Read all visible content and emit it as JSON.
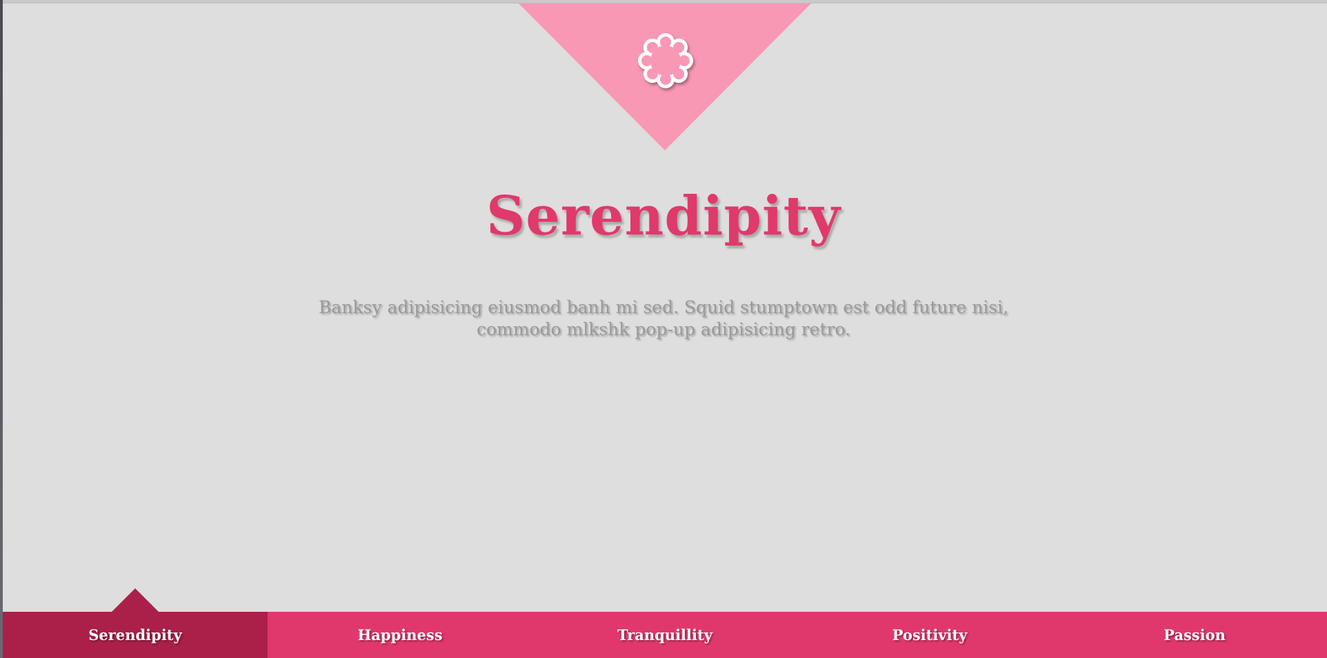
{
  "colors": {
    "background": "#dedede",
    "banner": "#f898b4",
    "accent": "#e0396b",
    "nav": "#e0386c",
    "nav_active": "#aa2048",
    "description": "#9a9a9a"
  },
  "banner": {
    "icon": "flower-icon"
  },
  "hero": {
    "title": "Serendipity",
    "description": "Banksy adipisicing eiusmod banh mi sed. Squid stumptown est odd future nisi, commodo mlkshk pop-up adipisicing retro."
  },
  "nav": {
    "items": [
      {
        "label": "Serendipity",
        "active": true
      },
      {
        "label": "Happiness",
        "active": false
      },
      {
        "label": "Tranquillity",
        "active": false
      },
      {
        "label": "Positivity",
        "active": false
      },
      {
        "label": "Passion",
        "active": false
      }
    ]
  }
}
